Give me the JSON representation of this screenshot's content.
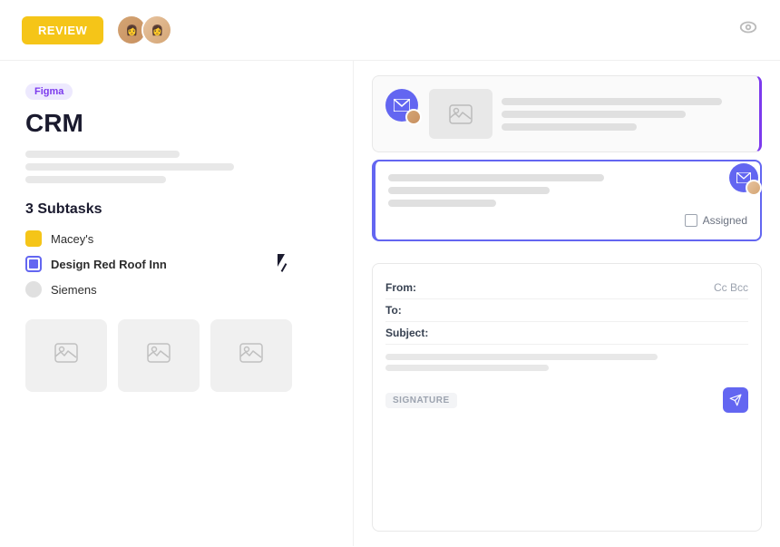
{
  "topBar": {
    "reviewButton": "REVIEW",
    "eyeIconLabel": "visibility-toggle"
  },
  "leftPanel": {
    "badge": "Figma",
    "title": "CRM",
    "subtasksHeading": "3 Subtasks",
    "subtasks": [
      {
        "label": "Macey's",
        "iconType": "yellow"
      },
      {
        "label": "Design Red Roof Inn",
        "iconType": "blue",
        "active": true
      },
      {
        "label": "Siemens",
        "iconType": "gray"
      }
    ],
    "thumbnails": [
      {
        "label": "thumbnail-1"
      },
      {
        "label": "thumbnail-2"
      },
      {
        "label": "thumbnail-3"
      }
    ]
  },
  "rightPanel": {
    "emailCard1": {
      "imageIcon": "🖼",
      "lines": [
        "line1",
        "line2",
        "line3"
      ]
    },
    "emailCard2": {
      "lines": [
        "line1",
        "line2",
        "line3"
      ],
      "assignedLabel": "Assigned"
    },
    "compose": {
      "fromLabel": "From:",
      "toLabel": "To:",
      "subjectLabel": "Subject:",
      "ccBcc": "Cc Bcc",
      "signatureBadge": "SIGNATURE"
    }
  }
}
